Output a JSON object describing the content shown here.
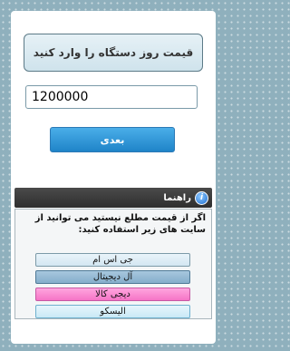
{
  "header": {
    "title": "قیمت روز دستگاه را وارد کنید"
  },
  "form": {
    "price_value": "1200000",
    "next_label": "بعدی"
  },
  "guide": {
    "title": "راهنما",
    "help_text": "اگر از قیمت مطلع نیستید می توانید از سایت های زیر استفاده کنید:",
    "sites": [
      "جی اس ام",
      "آل دیجیتال",
      "دیجی کالا",
      "الیسکو"
    ]
  }
}
